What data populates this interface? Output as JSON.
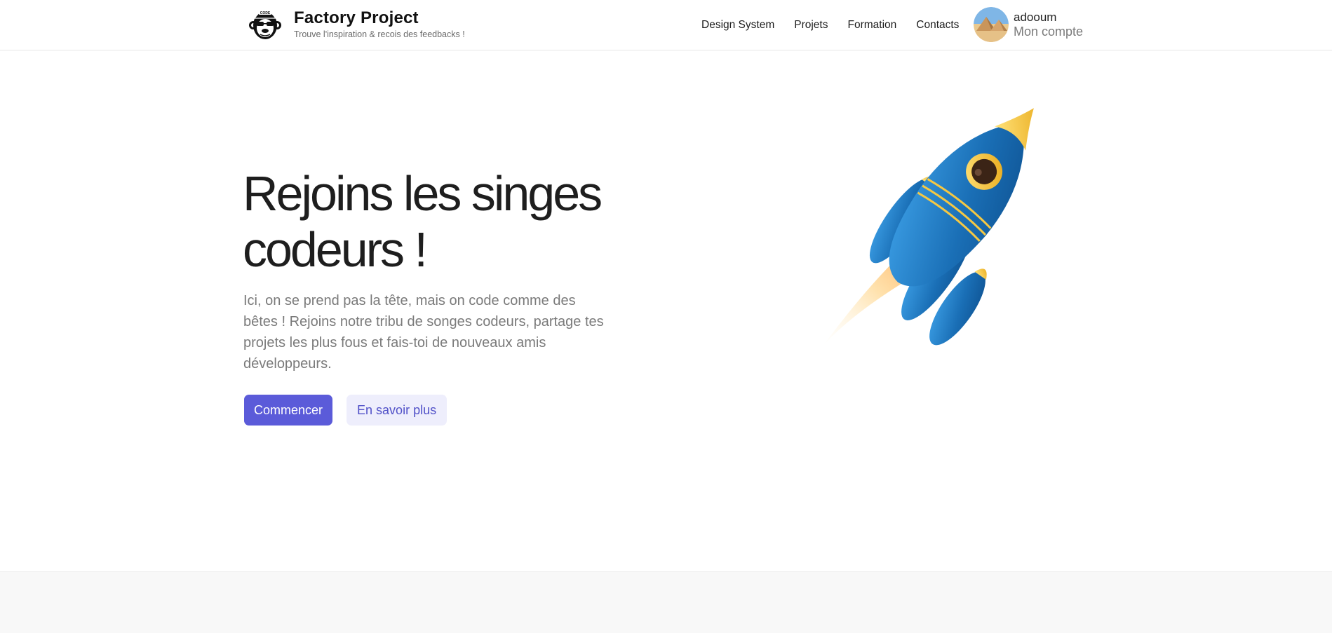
{
  "brand": {
    "title": "Factory Project",
    "tagline": "Trouve l'inspiration & recois des feedbacks !",
    "logo_icon": "monkey-logo-icon",
    "logo_badge_text": "CODE"
  },
  "nav": {
    "items": [
      {
        "label": "Design System"
      },
      {
        "label": "Projets"
      },
      {
        "label": "Formation"
      },
      {
        "label": "Contacts"
      }
    ]
  },
  "account": {
    "username": "adooum",
    "link_label": "Mon compte",
    "avatar_icon": "pyramids-avatar"
  },
  "hero": {
    "title_line1": "Rejoins les singes",
    "title_line2": "codeurs !",
    "lead": "Ici, on se prend pas la tête, mais on code comme des bêtes ! Rejoins notre tribu de songes codeurs, partage tes projets les plus fous et fais-toi de nouveaux amis développeurs.",
    "primary_button": "Commencer",
    "secondary_button": "En savoir plus",
    "illustration_icon": "rocket-icon"
  },
  "colors": {
    "primary": "#5b5bd9",
    "secondary_bg": "#eeeefc",
    "secondary_text": "#5151c8",
    "text_muted": "#7a7a7a",
    "rocket_blue": "#1e7bc4",
    "rocket_gold": "#f5c843"
  }
}
